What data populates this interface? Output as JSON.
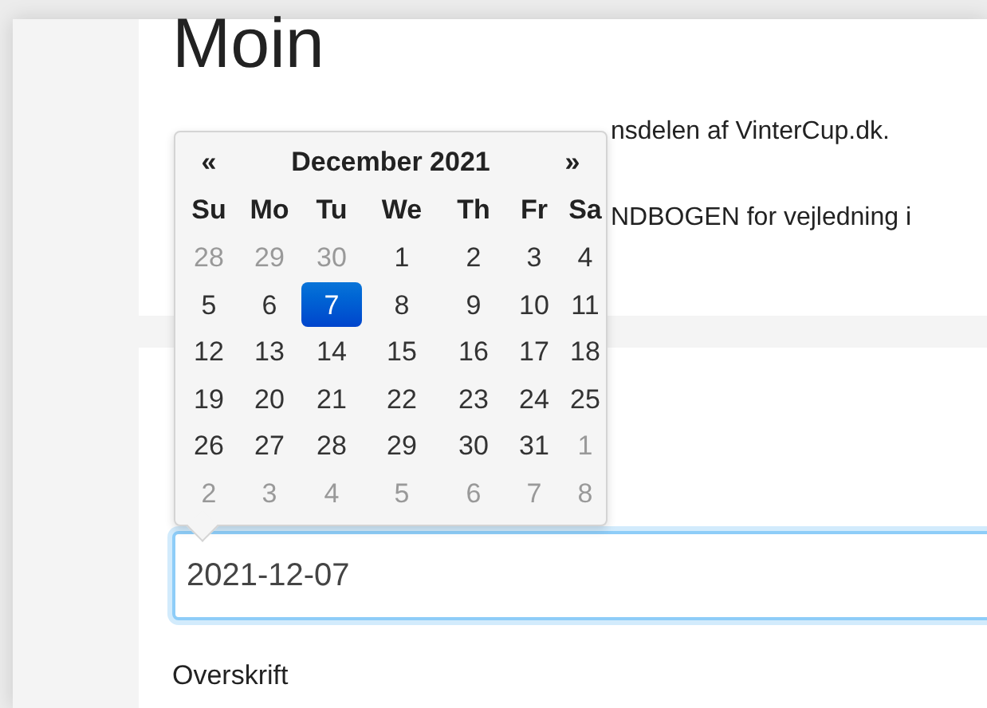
{
  "heading": "Moin",
  "intro_lines": [
    "nsdelen af VinterCup.dk.",
    "NDBOGEN for vejledning i"
  ],
  "datepicker": {
    "prev": "«",
    "title": "December 2021",
    "next": "»",
    "weekdays": [
      "Su",
      "Mo",
      "Tu",
      "We",
      "Th",
      "Fr",
      "Sa"
    ],
    "weeks": [
      [
        {
          "day": "28",
          "muted": true,
          "selected": false
        },
        {
          "day": "29",
          "muted": true,
          "selected": false
        },
        {
          "day": "30",
          "muted": true,
          "selected": false
        },
        {
          "day": "1",
          "muted": false,
          "selected": false
        },
        {
          "day": "2",
          "muted": false,
          "selected": false
        },
        {
          "day": "3",
          "muted": false,
          "selected": false
        },
        {
          "day": "4",
          "muted": false,
          "selected": false
        }
      ],
      [
        {
          "day": "5",
          "muted": false,
          "selected": false
        },
        {
          "day": "6",
          "muted": false,
          "selected": false
        },
        {
          "day": "7",
          "muted": false,
          "selected": true
        },
        {
          "day": "8",
          "muted": false,
          "selected": false
        },
        {
          "day": "9",
          "muted": false,
          "selected": false
        },
        {
          "day": "10",
          "muted": false,
          "selected": false
        },
        {
          "day": "11",
          "muted": false,
          "selected": false
        }
      ],
      [
        {
          "day": "12",
          "muted": false,
          "selected": false
        },
        {
          "day": "13",
          "muted": false,
          "selected": false
        },
        {
          "day": "14",
          "muted": false,
          "selected": false
        },
        {
          "day": "15",
          "muted": false,
          "selected": false
        },
        {
          "day": "16",
          "muted": false,
          "selected": false
        },
        {
          "day": "17",
          "muted": false,
          "selected": false
        },
        {
          "day": "18",
          "muted": false,
          "selected": false
        }
      ],
      [
        {
          "day": "19",
          "muted": false,
          "selected": false
        },
        {
          "day": "20",
          "muted": false,
          "selected": false
        },
        {
          "day": "21",
          "muted": false,
          "selected": false
        },
        {
          "day": "22",
          "muted": false,
          "selected": false
        },
        {
          "day": "23",
          "muted": false,
          "selected": false
        },
        {
          "day": "24",
          "muted": false,
          "selected": false
        },
        {
          "day": "25",
          "muted": false,
          "selected": false
        }
      ],
      [
        {
          "day": "26",
          "muted": false,
          "selected": false
        },
        {
          "day": "27",
          "muted": false,
          "selected": false
        },
        {
          "day": "28",
          "muted": false,
          "selected": false
        },
        {
          "day": "29",
          "muted": false,
          "selected": false
        },
        {
          "day": "30",
          "muted": false,
          "selected": false
        },
        {
          "day": "31",
          "muted": false,
          "selected": false
        },
        {
          "day": "1",
          "muted": true,
          "selected": false
        }
      ],
      [
        {
          "day": "2",
          "muted": true,
          "selected": false
        },
        {
          "day": "3",
          "muted": true,
          "selected": false
        },
        {
          "day": "4",
          "muted": true,
          "selected": false
        },
        {
          "day": "5",
          "muted": true,
          "selected": false
        },
        {
          "day": "6",
          "muted": true,
          "selected": false
        },
        {
          "day": "7",
          "muted": true,
          "selected": false
        },
        {
          "day": "8",
          "muted": true,
          "selected": false
        }
      ]
    ]
  },
  "date_field": {
    "value": "2021-12-07"
  },
  "field_label": "Overskrift"
}
